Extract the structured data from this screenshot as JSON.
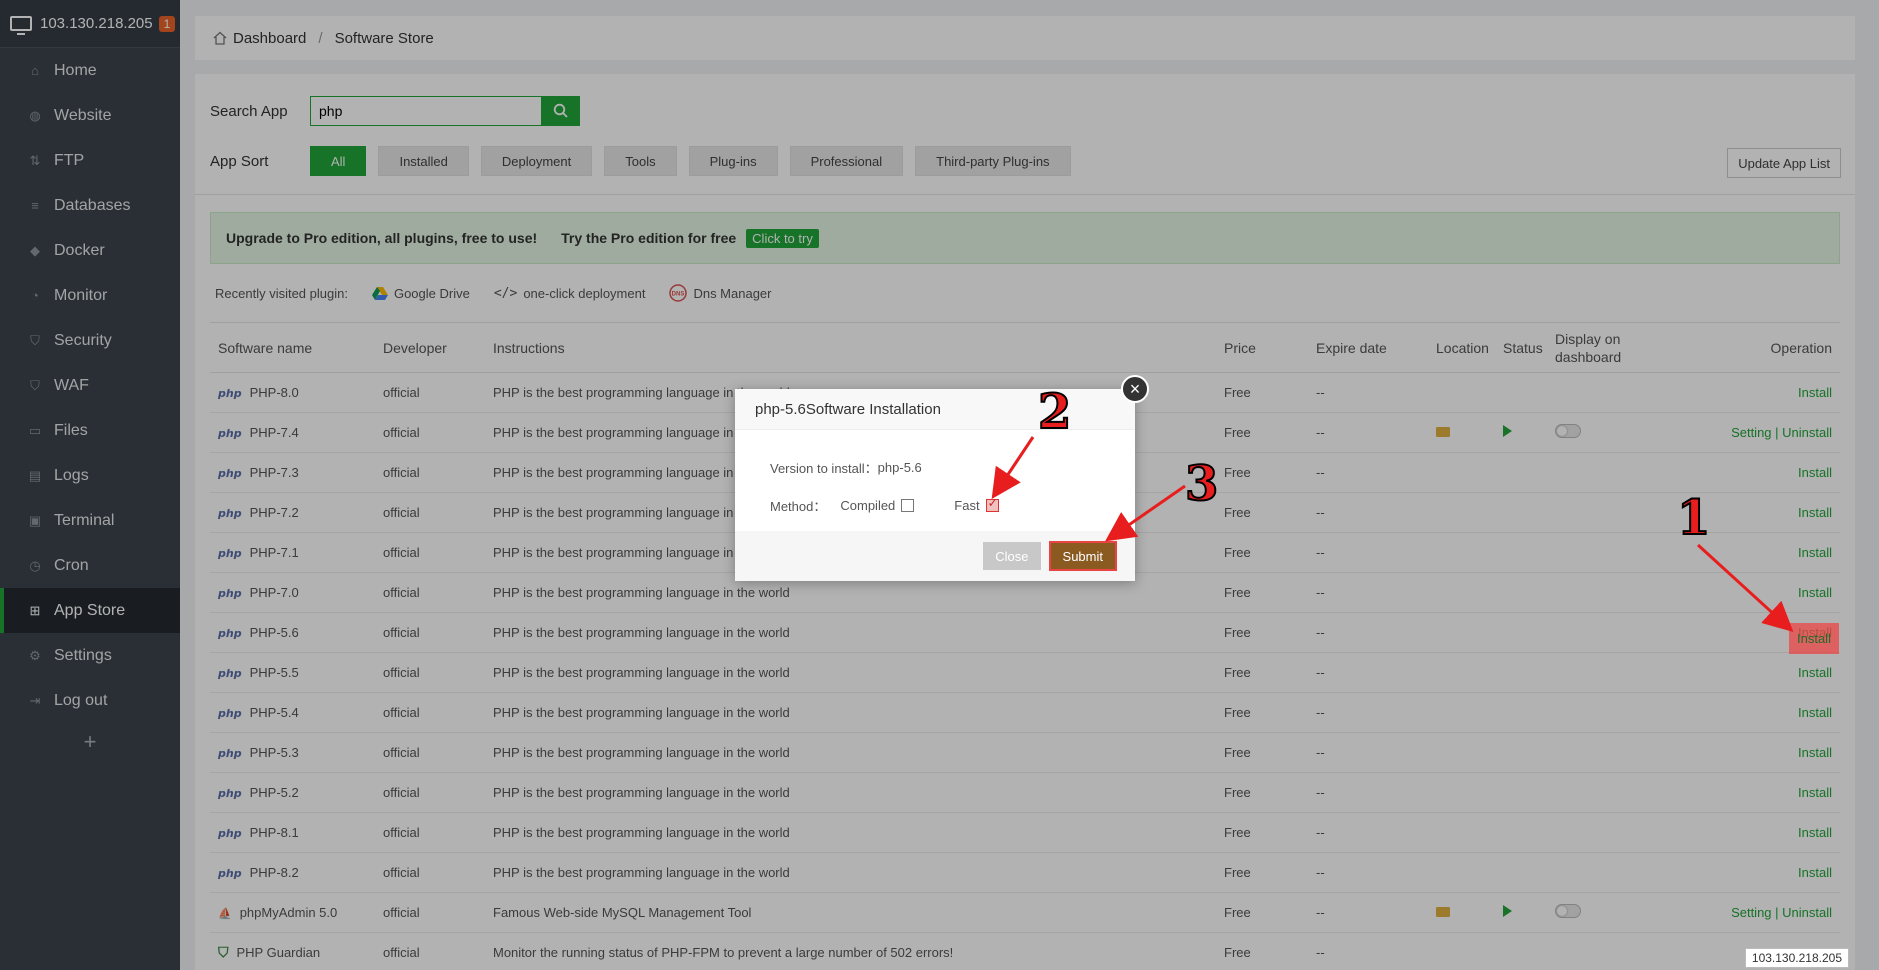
{
  "sidebar": {
    "server_ip": "103.130.218.205",
    "server_badge": "1",
    "items": [
      {
        "label": "Home",
        "icon": "home-icon"
      },
      {
        "label": "Website",
        "icon": "globe-icon"
      },
      {
        "label": "FTP",
        "icon": "ftp-icon"
      },
      {
        "label": "Databases",
        "icon": "database-icon"
      },
      {
        "label": "Docker",
        "icon": "docker-icon"
      },
      {
        "label": "Monitor",
        "icon": "monitor-icon"
      },
      {
        "label": "Security",
        "icon": "shield-icon"
      },
      {
        "label": "WAF",
        "icon": "waf-shield-icon"
      },
      {
        "label": "Files",
        "icon": "folder-icon"
      },
      {
        "label": "Logs",
        "icon": "document-icon"
      },
      {
        "label": "Terminal",
        "icon": "terminal-icon"
      },
      {
        "label": "Cron",
        "icon": "clock-icon"
      },
      {
        "label": "App Store",
        "icon": "grid-icon",
        "active": true
      },
      {
        "label": "Settings",
        "icon": "gear-icon"
      },
      {
        "label": "Log out",
        "icon": "logout-icon"
      }
    ],
    "add": "+"
  },
  "breadcrumb": {
    "home": "Dashboard",
    "sep": "/",
    "current": "Software Store"
  },
  "search": {
    "label": "Search App",
    "value": "php"
  },
  "sort": {
    "label": "App Sort",
    "options": [
      "All",
      "Installed",
      "Deployment",
      "Tools",
      "Plug-ins",
      "Professional",
      "Third-party Plug-ins"
    ],
    "active": "All"
  },
  "update_btn": "Update App List",
  "promo": {
    "text": "Upgrade to Pro edition, all plugins, free to use!",
    "try": "Try the Pro edition for free",
    "cta": "Click to try"
  },
  "recent": {
    "label": "Recently visited plugin:",
    "items": [
      "Google Drive",
      "one-click deployment",
      "Dns Manager"
    ]
  },
  "table": {
    "headers": {
      "name": "Software name",
      "developer": "Developer",
      "instructions": "Instructions",
      "price": "Price",
      "expire": "Expire date",
      "location": "Location",
      "status": "Status",
      "display": "Display on dashboard",
      "operation": "Operation"
    },
    "rows": [
      {
        "name": "PHP-8.0",
        "dev": "official",
        "desc": "PHP is the best programming language in the world",
        "price": "Free",
        "expire": "--",
        "op": "Install"
      },
      {
        "name": "PHP-7.4",
        "dev": "official",
        "desc": "PHP is the best programming language in the world",
        "price": "Free",
        "expire": "--",
        "op": "Setting | Uninstall",
        "installed": true
      },
      {
        "name": "PHP-7.3",
        "dev": "official",
        "desc": "PHP is the best programming language in the world",
        "price": "Free",
        "expire": "--",
        "op": "Install"
      },
      {
        "name": "PHP-7.2",
        "dev": "official",
        "desc": "PHP is the best programming language in the world",
        "price": "Free",
        "expire": "--",
        "op": "Install"
      },
      {
        "name": "PHP-7.1",
        "dev": "official",
        "desc": "PHP is the best programming language in the world",
        "price": "Free",
        "expire": "--",
        "op": "Install"
      },
      {
        "name": "PHP-7.0",
        "dev": "official",
        "desc": "PHP is the best programming language in the world",
        "price": "Free",
        "expire": "--",
        "op": "Install"
      },
      {
        "name": "PHP-5.6",
        "dev": "official",
        "desc": "PHP is the best programming language in the world",
        "price": "Free",
        "expire": "--",
        "op": "Install"
      },
      {
        "name": "PHP-5.5",
        "dev": "official",
        "desc": "PHP is the best programming language in the world",
        "price": "Free",
        "expire": "--",
        "op": "Install"
      },
      {
        "name": "PHP-5.4",
        "dev": "official",
        "desc": "PHP is the best programming language in the world",
        "price": "Free",
        "expire": "--",
        "op": "Install"
      },
      {
        "name": "PHP-5.3",
        "dev": "official",
        "desc": "PHP is the best programming language in the world",
        "price": "Free",
        "expire": "--",
        "op": "Install"
      },
      {
        "name": "PHP-5.2",
        "dev": "official",
        "desc": "PHP is the best programming language in the world",
        "price": "Free",
        "expire": "--",
        "op": "Install"
      },
      {
        "name": "PHP-8.1",
        "dev": "official",
        "desc": "PHP is the best programming language in the world",
        "price": "Free",
        "expire": "--",
        "op": "Install"
      },
      {
        "name": "PHP-8.2",
        "dev": "official",
        "desc": "PHP is the best programming language in the world",
        "price": "Free",
        "expire": "--",
        "op": "Install"
      },
      {
        "name": "phpMyAdmin 5.0",
        "dev": "official",
        "desc": "Famous Web-side MySQL Management Tool",
        "price": "Free",
        "expire": "--",
        "op": "Setting | Uninstall",
        "installed": true
      },
      {
        "name": "PHP Guardian",
        "dev": "official",
        "desc": "Monitor the running status of PHP-FPM to prevent a large number of 502 errors!",
        "price": "Free",
        "expire": "--",
        "op": ""
      }
    ]
  },
  "dialog": {
    "title": "php-5.6Software Installation",
    "close_x": "×",
    "version_label": "Version to install：",
    "version": "php-5.6",
    "method_label": "Method：",
    "compiled": "Compiled",
    "fast": "Fast",
    "close_btn": "Close",
    "submit_btn": "Submit"
  },
  "annotations": [
    "1",
    "2",
    "3"
  ],
  "tooltip_ip": "103.130.218.205",
  "colors": {
    "accent": "#20a53a",
    "sidebar": "#3c444d",
    "submit": "#8a5a21",
    "annotation": "#e81e1e"
  }
}
